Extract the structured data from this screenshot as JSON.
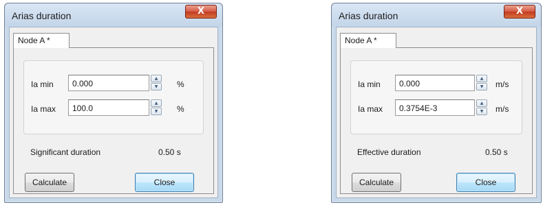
{
  "dialogs": [
    {
      "title": "Arias duration",
      "close_glyph": "X",
      "tab": "Node A *",
      "ia_min": {
        "label": "Ia min",
        "value": "0.000",
        "unit": "%"
      },
      "ia_max": {
        "label": "Ia max",
        "value": "100.0",
        "unit": "%"
      },
      "duration_label": "Significant duration",
      "duration_value": "0.50 s",
      "calculate_label": "Calculate",
      "close_label": "Close"
    },
    {
      "title": "Arias duration",
      "close_glyph": "X",
      "tab": "Node A *",
      "ia_min": {
        "label": "Ia min",
        "value": "0.000",
        "unit": "m/s"
      },
      "ia_max": {
        "label": "Ia max",
        "value": "0.3754E-3",
        "unit": "m/s"
      },
      "duration_label": "Effective duration",
      "duration_value": "0.50 s",
      "calculate_label": "Calculate",
      "close_label": "Close"
    }
  ],
  "icons": {
    "spin_up": "▲",
    "spin_down": "▼"
  },
  "colors": {
    "close_button_accent": "#c23a22",
    "default_button_border": "#3c7fb1",
    "window_frame": "#c9d9ea"
  }
}
